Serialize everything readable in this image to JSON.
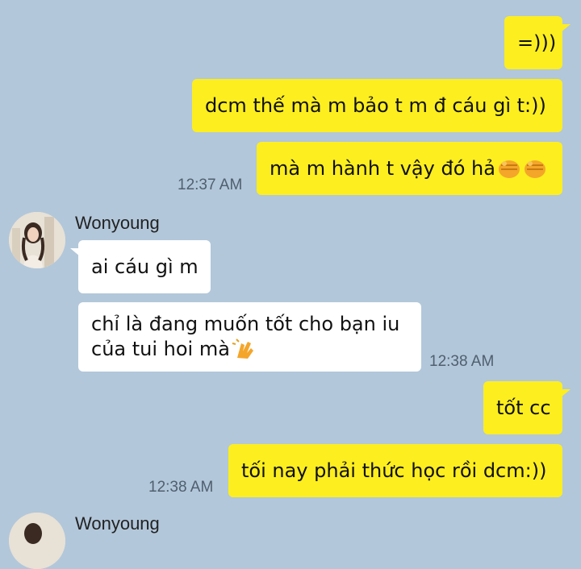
{
  "contact_name": "Wonyoung",
  "messages": [
    {
      "text": "=)))"
    },
    {
      "text": "dcm thế mà m bảo t m đ cáu gì t:))"
    },
    {
      "text": "mà m hành t vậy đó hả",
      "emoji": [
        "punch-emoji",
        "punch-emoji"
      ],
      "time": "12:37 AM"
    },
    {
      "text": "ai cáu gì m"
    },
    {
      "line1": "chỉ là đang muốn tốt cho bạn iu",
      "line2": "của tui hoi mà",
      "emoji": [
        "clapping-hands-emoji"
      ],
      "time": "12:38 AM"
    },
    {
      "text": "tốt cc"
    },
    {
      "text": "tối nay phải thức học rồi dcm:))",
      "time": "12:38 AM"
    }
  ],
  "colors": {
    "background": "#b2c7da",
    "outgoing_bubble": "#fdee1f",
    "incoming_bubble": "#ffffff",
    "timestamp": "#4f5f6f"
  }
}
